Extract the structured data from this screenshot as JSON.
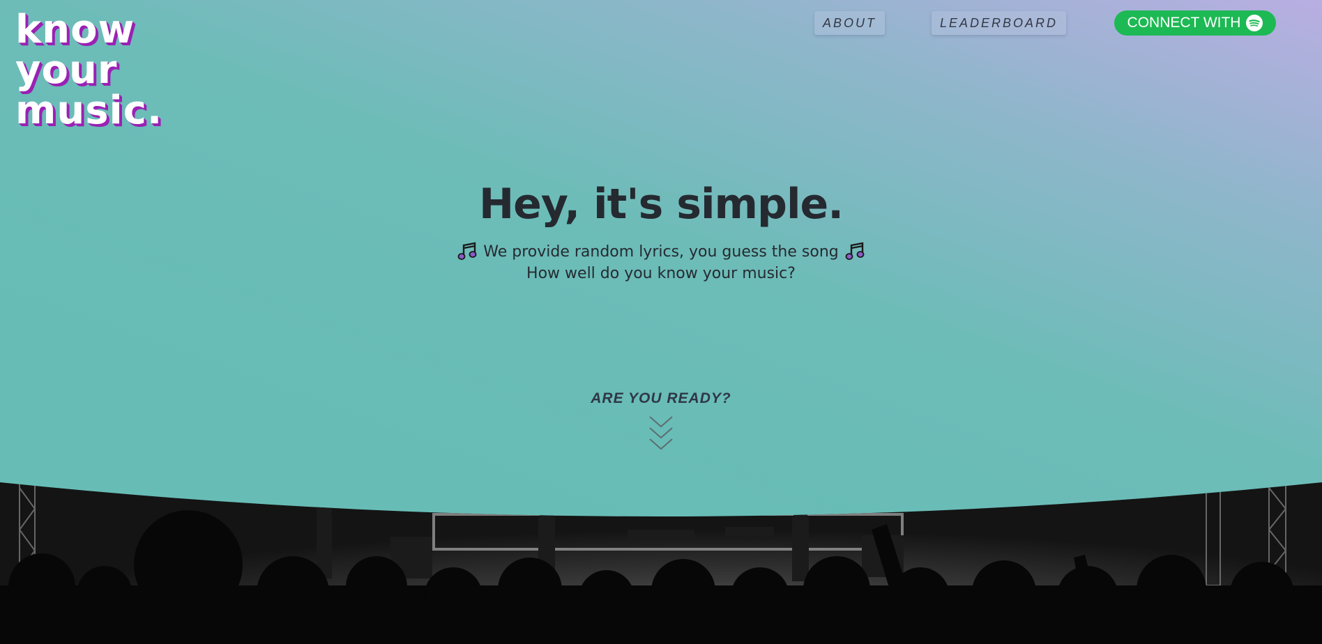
{
  "logo": {
    "text": "know\nyour\nmusic."
  },
  "nav": {
    "about_label": "ABOUT",
    "leaderboard_label": "LEADERBOARD",
    "connect_label": "CONNECT WITH"
  },
  "hero": {
    "headline": "Hey, it's simple.",
    "subline1": "We provide random lyrics, you guess the song",
    "subline2": "How well do you know your music?",
    "cta": "ARE YOU READY?"
  },
  "colors": {
    "accent_purple": "#9a21b4",
    "spotify_green": "#1db954",
    "teal": "#67bdb6",
    "lavender": "#b9aee2"
  },
  "icons": [
    "spotify-icon",
    "music-note-icon",
    "chevron-down-icon"
  ]
}
